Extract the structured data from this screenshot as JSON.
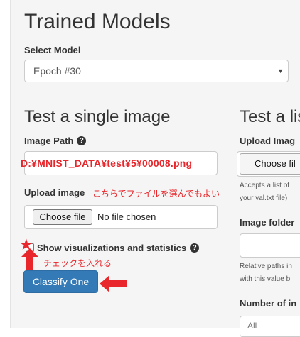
{
  "page": {
    "title": "Trained Models",
    "select_label": "Select Model",
    "selected_model": "Epoch #30"
  },
  "single": {
    "heading": "Test a single image",
    "image_path_label": "Image Path",
    "image_path_annotation": "D:¥MNIST_DATA¥test¥5¥00008.png",
    "upload_label": "Upload image",
    "upload_note": "こちらでファイルを選んでもよい",
    "choose_file_label": "Choose file",
    "no_file_text": "No file chosen",
    "show_vis_label": "Show visualizations and statistics",
    "check_note": "チェックを入れる",
    "classify_label": "Classify One"
  },
  "list": {
    "heading": "Test a lis",
    "upload_label": "Upload Imag",
    "choose_file_label": "Choose fil",
    "accepts_text_1": "Accepts a list of",
    "accepts_text_2": "your val.txt file)",
    "image_folder_label": "Image folder",
    "relative_text_1": "Relative paths in",
    "relative_text_2": "with this value b",
    "number_label": "Number of in",
    "number_placeholder": "All"
  },
  "colors": {
    "annotation_red": "#e8262b",
    "primary_button": "#337ab7",
    "panel_bg": "#f5f5f5"
  }
}
